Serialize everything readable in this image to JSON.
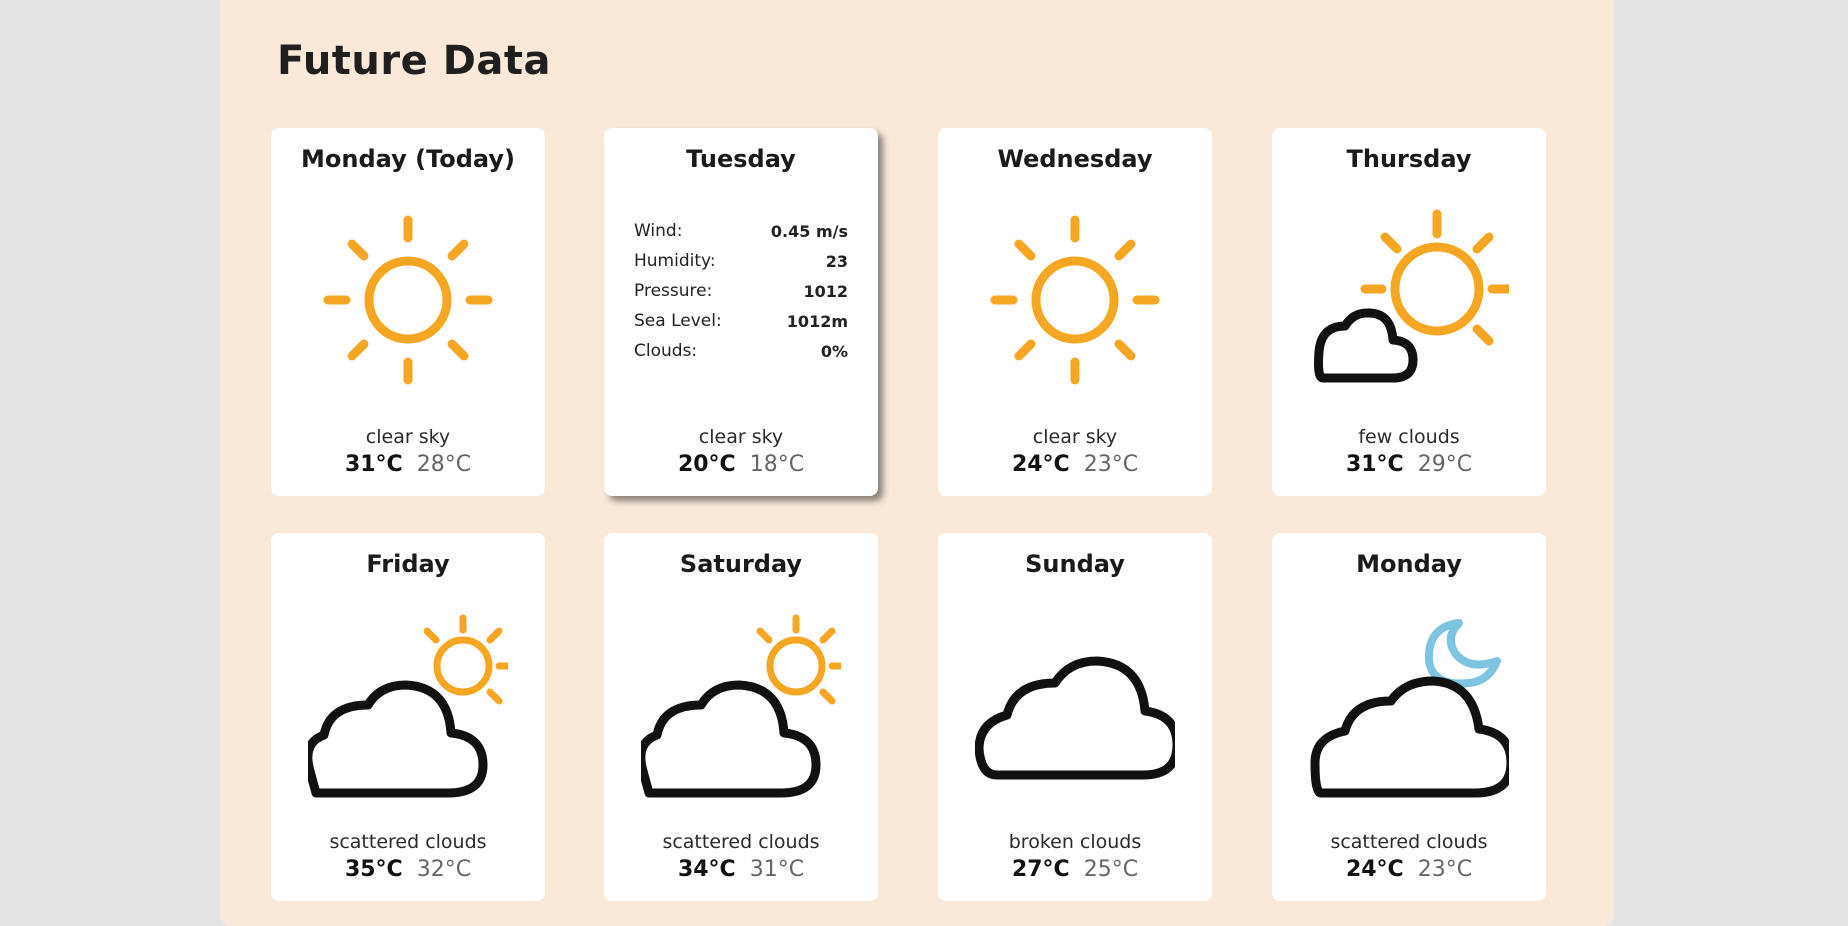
{
  "page": {
    "title": "Future Data"
  },
  "colors": {
    "sun": "#f5a623",
    "moon": "#7ec3e0",
    "cloud": "#111111",
    "panel": "#fae9d9"
  },
  "days": [
    {
      "name": "Monday (Today)",
      "icon": "sun-icon",
      "description": "clear sky",
      "high": "31°C",
      "low": "28°C"
    },
    {
      "name": "Tuesday",
      "icon": "sun-icon",
      "description": "clear sky",
      "high": "20°C",
      "low": "18°C",
      "details": [
        {
          "label": "Wind:",
          "value": "0.45 m/s"
        },
        {
          "label": "Humidity:",
          "value": "23"
        },
        {
          "label": "Pressure:",
          "value": "1012"
        },
        {
          "label": "Sea Level:",
          "value": "1012m"
        },
        {
          "label": "Clouds:",
          "value": "0%"
        }
      ]
    },
    {
      "name": "Wednesday",
      "icon": "sun-icon",
      "description": "clear sky",
      "high": "24°C",
      "low": "23°C"
    },
    {
      "name": "Thursday",
      "icon": "sun-behind-cloud-icon",
      "description": "few clouds",
      "high": "31°C",
      "low": "29°C"
    },
    {
      "name": "Friday",
      "icon": "cloud-with-sun-icon",
      "description": "scattered clouds",
      "high": "35°C",
      "low": "32°C"
    },
    {
      "name": "Saturday",
      "icon": "cloud-with-sun-icon",
      "description": "scattered clouds",
      "high": "34°C",
      "low": "31°C"
    },
    {
      "name": "Sunday",
      "icon": "cloud-icon",
      "description": "broken clouds",
      "high": "27°C",
      "low": "25°C"
    },
    {
      "name": "Monday",
      "icon": "cloud-with-moon-icon",
      "description": "scattered clouds",
      "high": "24°C",
      "low": "23°C"
    }
  ]
}
